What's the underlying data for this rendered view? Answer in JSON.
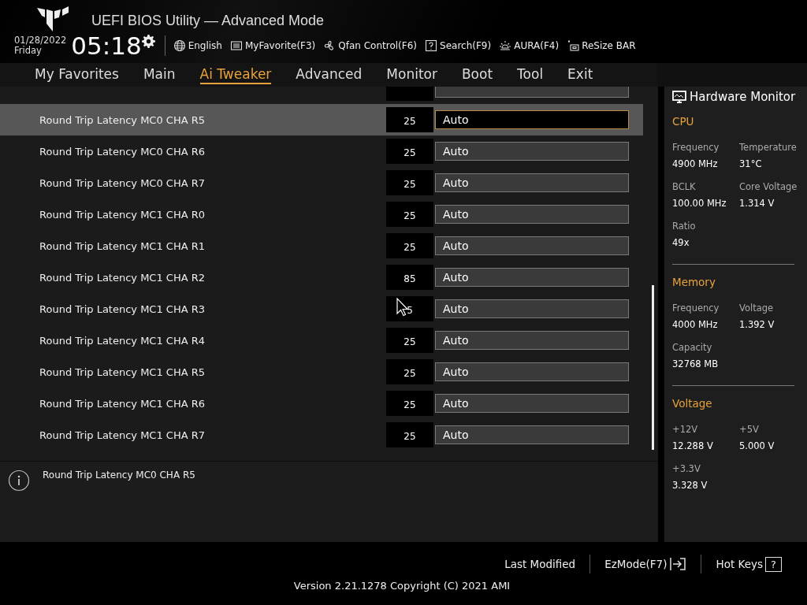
{
  "header": {
    "title": "UEFI BIOS Utility — Advanced Mode",
    "date": "01/28/2022",
    "day": "Friday",
    "time": "05:18",
    "tools": [
      {
        "kind": "globe",
        "label": "English"
      },
      {
        "kind": "list",
        "label": "MyFavorite(F3)"
      },
      {
        "kind": "fan",
        "label": "Qfan Control(F6)"
      },
      {
        "kind": "help",
        "label": "Search(F9)"
      },
      {
        "kind": "aura",
        "label": "AURA(F4)"
      },
      {
        "kind": "resize",
        "label": "ReSize BAR"
      }
    ]
  },
  "tabs": [
    {
      "label": "My Favorites",
      "selected": false
    },
    {
      "label": "Main",
      "selected": false
    },
    {
      "label": "Ai Tweaker",
      "selected": true
    },
    {
      "label": "Advanced",
      "selected": false
    },
    {
      "label": "Monitor",
      "selected": false
    },
    {
      "label": "Boot",
      "selected": false
    },
    {
      "label": "Tool",
      "selected": false
    },
    {
      "label": "Exit",
      "selected": false
    }
  ],
  "settings": [
    {
      "label": "Round Trip Latency MC0 CHA R5",
      "value": "25",
      "option": "Auto",
      "selected": true
    },
    {
      "label": "Round Trip Latency MC0 CHA R6",
      "value": "25",
      "option": "Auto",
      "selected": false
    },
    {
      "label": "Round Trip Latency MC0 CHA R7",
      "value": "25",
      "option": "Auto",
      "selected": false
    },
    {
      "label": "Round Trip Latency MC1 CHA R0",
      "value": "25",
      "option": "Auto",
      "selected": false
    },
    {
      "label": "Round Trip Latency MC1 CHA R1",
      "value": "25",
      "option": "Auto",
      "selected": false
    },
    {
      "label": "Round Trip Latency MC1 CHA R2",
      "value": "85",
      "option": "Auto",
      "selected": false
    },
    {
      "label": "Round Trip Latency MC1 CHA R3",
      "value": "5",
      "option": "Auto",
      "selected": false
    },
    {
      "label": "Round Trip Latency MC1 CHA R4",
      "value": "25",
      "option": "Auto",
      "selected": false
    },
    {
      "label": "Round Trip Latency MC1 CHA R5",
      "value": "25",
      "option": "Auto",
      "selected": false
    },
    {
      "label": "Round Trip Latency MC1 CHA R6",
      "value": "25",
      "option": "Auto",
      "selected": false
    },
    {
      "label": "Round Trip Latency MC1 CHA R7",
      "value": "25",
      "option": "Auto",
      "selected": false
    }
  ],
  "help": {
    "text": "Round Trip Latency MC0 CHA R5"
  },
  "hardware_monitor": {
    "title": "Hardware Monitor",
    "sections": [
      {
        "title": "CPU",
        "items": [
          {
            "label": "Frequency",
            "value": "4900 MHz"
          },
          {
            "label": "Temperature",
            "value": "31°C"
          },
          {
            "label": "BCLK",
            "value": "100.00 MHz"
          },
          {
            "label": "Core Voltage",
            "value": "1.314 V"
          },
          {
            "label": "Ratio",
            "value": "49x"
          }
        ]
      },
      {
        "title": "Memory",
        "items": [
          {
            "label": "Frequency",
            "value": "4000 MHz"
          },
          {
            "label": "Voltage",
            "value": "1.392 V"
          },
          {
            "label": "Capacity",
            "value": "32768 MB"
          }
        ]
      },
      {
        "title": "Voltage",
        "items": [
          {
            "label": "+12V",
            "value": "12.288 V"
          },
          {
            "label": "+5V",
            "value": "5.000 V"
          },
          {
            "label": "+3.3V",
            "value": "3.328 V"
          }
        ]
      }
    ]
  },
  "footer": {
    "links": [
      {
        "kind": "plain",
        "label": "Last Modified"
      },
      {
        "kind": "ezmode",
        "label": "EzMode(F7)"
      },
      {
        "kind": "hotkeys",
        "label": "Hot Keys",
        "key": "?"
      }
    ],
    "version": "Version 2.21.1278 Copyright (C) 2021 AMI"
  }
}
